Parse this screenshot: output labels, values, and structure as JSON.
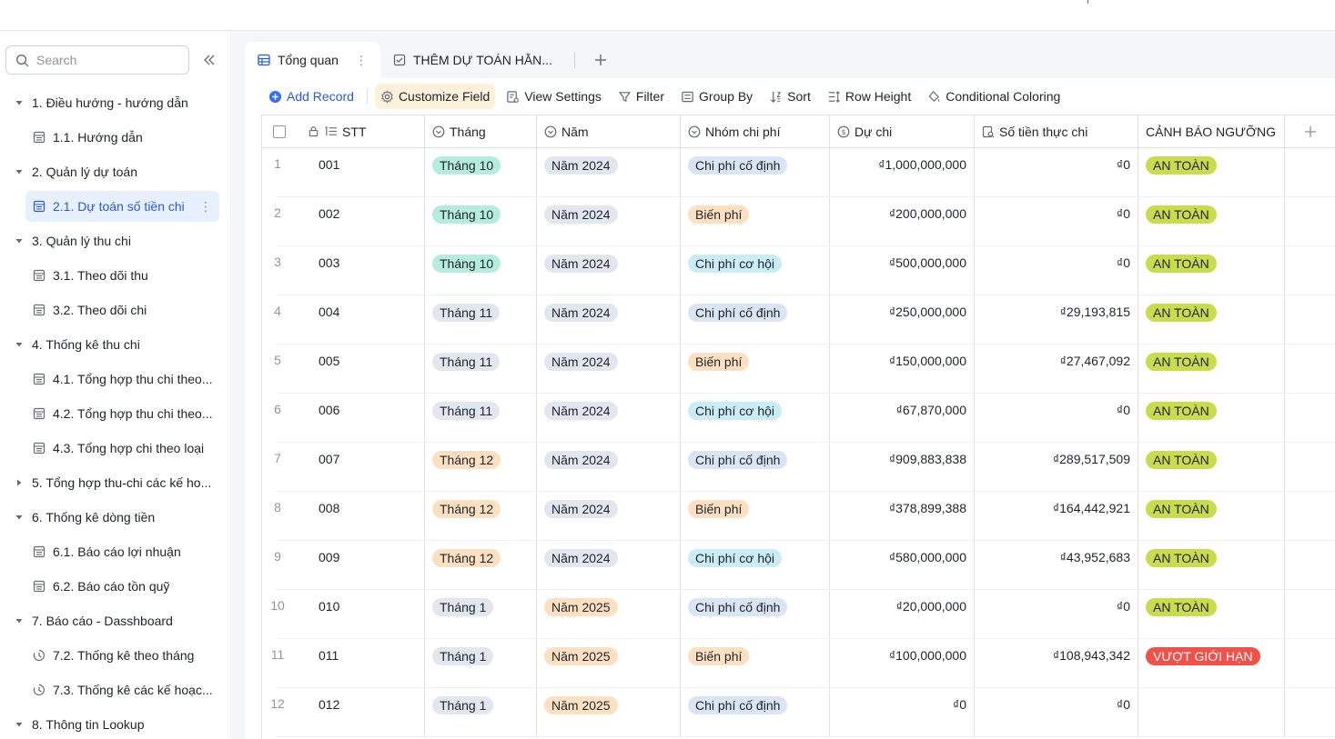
{
  "sidebar": {
    "search_placeholder": "Search",
    "items": [
      {
        "label": "1. Điều hướng - hướng dẫn",
        "level": 1,
        "type": "folder",
        "expanded": true
      },
      {
        "label": "1.1. Hướng dẫn",
        "level": 2,
        "type": "table"
      },
      {
        "label": "2. Quản lý dự toán",
        "level": 1,
        "type": "folder",
        "expanded": true
      },
      {
        "label": "2.1. Dự toán số tiền chi",
        "level": 2,
        "type": "table",
        "active": true
      },
      {
        "label": "3. Quản lý thu chi",
        "level": 1,
        "type": "folder",
        "expanded": true
      },
      {
        "label": "3.1. Theo dõi thu",
        "level": 2,
        "type": "table"
      },
      {
        "label": "3.2. Theo dõi chi",
        "level": 2,
        "type": "table"
      },
      {
        "label": "4. Thống kê thu chi",
        "level": 1,
        "type": "folder",
        "expanded": true
      },
      {
        "label": "4.1. Tổng hợp thu chi theo...",
        "level": 2,
        "type": "table"
      },
      {
        "label": "4.2. Tổng hợp thu chi theo...",
        "level": 2,
        "type": "table"
      },
      {
        "label": "4.3. Tổng hợp chi theo loại",
        "level": 2,
        "type": "table"
      },
      {
        "label": "5. Tổng hợp thu-chi các kế ho...",
        "level": 1,
        "type": "folder",
        "expanded": false
      },
      {
        "label": "6. Thống kê dòng tiền",
        "level": 1,
        "type": "folder",
        "expanded": true
      },
      {
        "label": "6.1. Báo cáo lợi nhuận",
        "level": 2,
        "type": "table"
      },
      {
        "label": "6.2. Báo cáo tồn quỹ",
        "level": 2,
        "type": "table"
      },
      {
        "label": "7. Báo cáo - Dasshboard",
        "level": 1,
        "type": "folder",
        "expanded": true
      },
      {
        "label": "7.2. Thống kê theo tháng",
        "level": 2,
        "type": "dashboard"
      },
      {
        "label": "7.3. Thống kê các kế hoạc...",
        "level": 2,
        "type": "dashboard"
      },
      {
        "label": "8. Thông tin Lookup",
        "level": 1,
        "type": "folder",
        "expanded": true
      }
    ]
  },
  "tabs": [
    {
      "label": "Tổng quan",
      "active": true
    },
    {
      "label": "THÊM DỰ TOÁN HẰN...",
      "active": false
    }
  ],
  "toolbar": {
    "add_record": "Add Record",
    "customize_field": "Customize Field",
    "view_settings": "View Settings",
    "filter": "Filter",
    "group_by": "Group By",
    "sort": "Sort",
    "row_height": "Row Height",
    "conditional_coloring": "Conditional Coloring"
  },
  "columns": {
    "stt": "STT",
    "thang": "Tháng",
    "nam": "Năm",
    "nhom": "Nhóm chi phí",
    "du_chi": "Dự chi",
    "thuc_chi": "Số tiền thực chi",
    "canh_bao": "CẢNH BÁO NGƯỠNG"
  },
  "colors": {
    "accent": "#245bdb",
    "month_10": "#b6ecdd",
    "month_11": "#e2e6ef",
    "month_12": "#fde0c2",
    "month_1": "#e2e6ef",
    "year_2024": "#e2e6ef",
    "year_2025": "#fde0c2",
    "group_fixed": "#d9e4f5",
    "group_variable": "#fde0c2",
    "group_opportunity": "#c9ecf7",
    "safe": "#c8dc4d",
    "over": "#f2514a"
  },
  "rows": [
    {
      "idx": "1",
      "stt": "001",
      "thang": "Tháng 10",
      "thang_key": "month_10",
      "nam": "Năm 2024",
      "nam_key": "year_2024",
      "nhom": "Chi phí cố định",
      "nhom_key": "group_fixed",
      "du_chi": "₫1,000,000,000",
      "thuc_chi": "₫0",
      "canh_bao": "AN TOÀN",
      "canh_key": "safe"
    },
    {
      "idx": "2",
      "stt": "002",
      "thang": "Tháng 10",
      "thang_key": "month_10",
      "nam": "Năm 2024",
      "nam_key": "year_2024",
      "nhom": "Biến phí",
      "nhom_key": "group_variable",
      "du_chi": "₫200,000,000",
      "thuc_chi": "₫0",
      "canh_bao": "AN TOÀN",
      "canh_key": "safe"
    },
    {
      "idx": "3",
      "stt": "003",
      "thang": "Tháng 10",
      "thang_key": "month_10",
      "nam": "Năm 2024",
      "nam_key": "year_2024",
      "nhom": "Chi phí cơ hội",
      "nhom_key": "group_opportunity",
      "du_chi": "₫500,000,000",
      "thuc_chi": "₫0",
      "canh_bao": "AN TOÀN",
      "canh_key": "safe"
    },
    {
      "idx": "4",
      "stt": "004",
      "thang": "Tháng 11",
      "thang_key": "month_11",
      "nam": "Năm 2024",
      "nam_key": "year_2024",
      "nhom": "Chi phí cố định",
      "nhom_key": "group_fixed",
      "du_chi": "₫250,000,000",
      "thuc_chi": "₫29,193,815",
      "canh_bao": "AN TOÀN",
      "canh_key": "safe"
    },
    {
      "idx": "5",
      "stt": "005",
      "thang": "Tháng 11",
      "thang_key": "month_11",
      "nam": "Năm 2024",
      "nam_key": "year_2024",
      "nhom": "Biến phí",
      "nhom_key": "group_variable",
      "du_chi": "₫150,000,000",
      "thuc_chi": "₫27,467,092",
      "canh_bao": "AN TOÀN",
      "canh_key": "safe"
    },
    {
      "idx": "6",
      "stt": "006",
      "thang": "Tháng 11",
      "thang_key": "month_11",
      "nam": "Năm 2024",
      "nam_key": "year_2024",
      "nhom": "Chi phí cơ hội",
      "nhom_key": "group_opportunity",
      "du_chi": "₫67,870,000",
      "thuc_chi": "₫0",
      "canh_bao": "AN TOÀN",
      "canh_key": "safe"
    },
    {
      "idx": "7",
      "stt": "007",
      "thang": "Tháng 12",
      "thang_key": "month_12",
      "nam": "Năm 2024",
      "nam_key": "year_2024",
      "nhom": "Chi phí cố định",
      "nhom_key": "group_fixed",
      "du_chi": "₫909,883,838",
      "thuc_chi": "₫289,517,509",
      "canh_bao": "AN TOÀN",
      "canh_key": "safe"
    },
    {
      "idx": "8",
      "stt": "008",
      "thang": "Tháng 12",
      "thang_key": "month_12",
      "nam": "Năm 2024",
      "nam_key": "year_2024",
      "nhom": "Biến phí",
      "nhom_key": "group_variable",
      "du_chi": "₫378,899,388",
      "thuc_chi": "₫164,442,921",
      "canh_bao": "AN TOÀN",
      "canh_key": "safe"
    },
    {
      "idx": "9",
      "stt": "009",
      "thang": "Tháng 12",
      "thang_key": "month_12",
      "nam": "Năm 2024",
      "nam_key": "year_2024",
      "nhom": "Chi phí cơ hội",
      "nhom_key": "group_opportunity",
      "du_chi": "₫580,000,000",
      "thuc_chi": "₫43,952,683",
      "canh_bao": "AN TOÀN",
      "canh_key": "safe"
    },
    {
      "idx": "10",
      "stt": "010",
      "thang": "Tháng 1",
      "thang_key": "month_1",
      "nam": "Năm 2025",
      "nam_key": "year_2025",
      "nhom": "Chi phí cố định",
      "nhom_key": "group_fixed",
      "du_chi": "₫20,000,000",
      "thuc_chi": "₫0",
      "canh_bao": "AN TOÀN",
      "canh_key": "safe"
    },
    {
      "idx": "11",
      "stt": "011",
      "thang": "Tháng 1",
      "thang_key": "month_1",
      "nam": "Năm 2025",
      "nam_key": "year_2025",
      "nhom": "Biến phí",
      "nhom_key": "group_variable",
      "du_chi": "₫100,000,000",
      "thuc_chi": "₫108,943,342",
      "canh_bao": "VƯỢT GIỚI HẠN",
      "canh_key": "over"
    },
    {
      "idx": "12",
      "stt": "012",
      "thang": "Tháng 1",
      "thang_key": "month_1",
      "nam": "Năm 2025",
      "nam_key": "year_2025",
      "nhom": "Chi phí cố định",
      "nhom_key": "group_fixed",
      "du_chi": "₫0",
      "thuc_chi": "₫0",
      "canh_bao": "",
      "canh_key": ""
    }
  ]
}
